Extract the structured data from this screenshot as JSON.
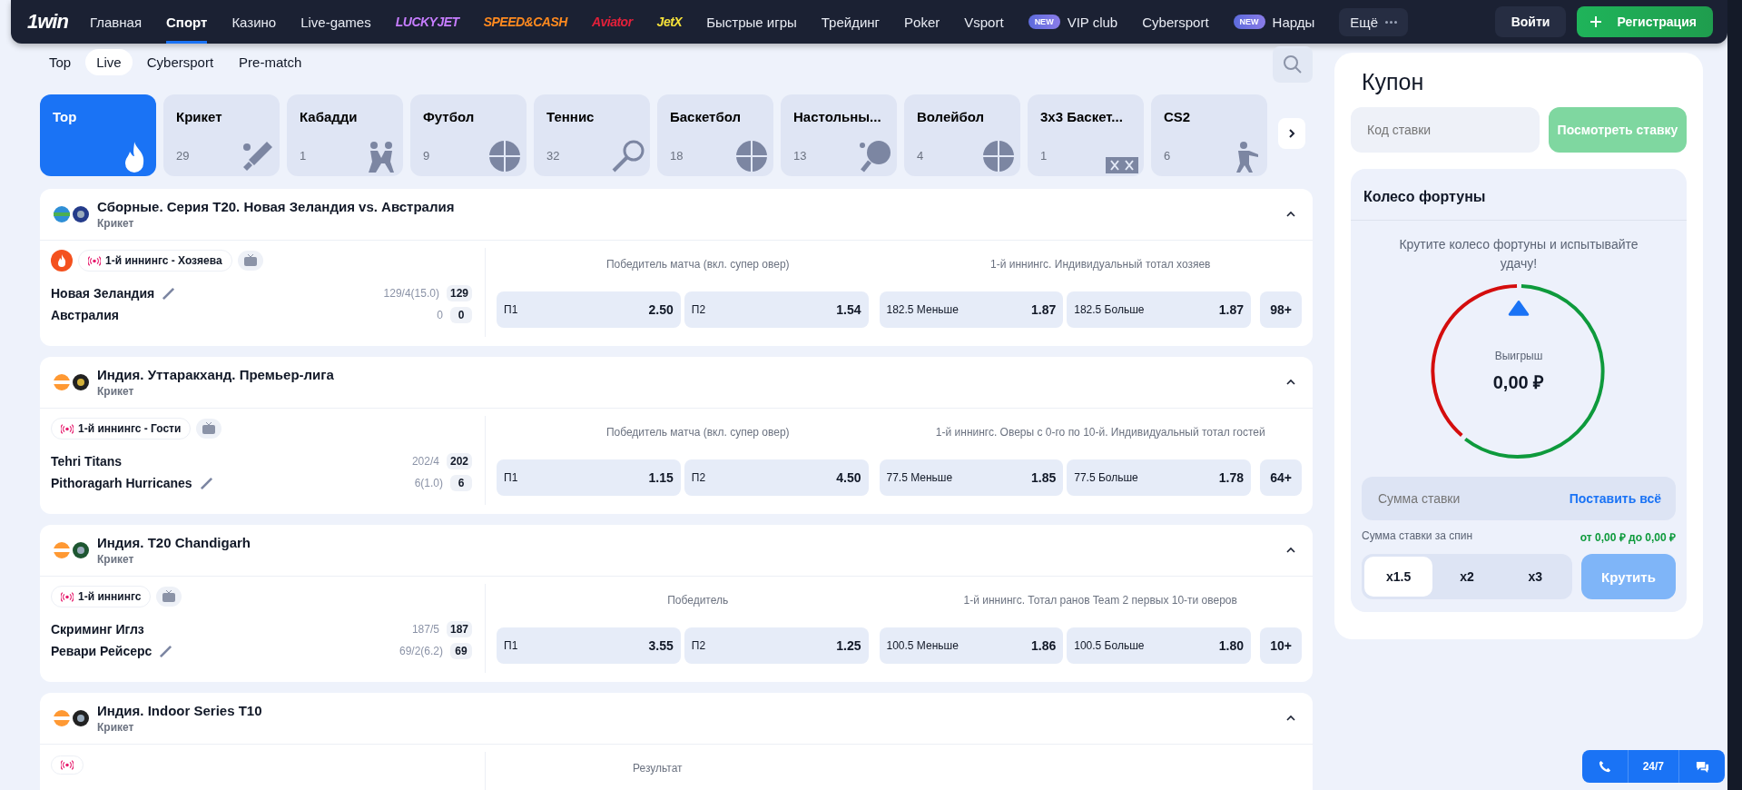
{
  "header": {
    "logo": "1win",
    "nav": [
      {
        "label": "Главная",
        "kind": "text",
        "selected": false
      },
      {
        "label": "Спорт",
        "kind": "text",
        "selected": true
      },
      {
        "label": "Казино",
        "kind": "text",
        "selected": false
      },
      {
        "label": "Live-games",
        "kind": "text",
        "selected": false
      },
      {
        "label": "LUCKYJET",
        "kind": "logo",
        "color": "#c77dff",
        "selected": false
      },
      {
        "label": "SPEED&CASH",
        "kind": "logo",
        "color": "#ff8a1f",
        "selected": false
      },
      {
        "label": "Aviator",
        "kind": "logo",
        "color": "#e3203a",
        "selected": false
      },
      {
        "label": "JetX",
        "kind": "logo",
        "color": "#f5e13a",
        "selected": false
      },
      {
        "label": "Быстрые игры",
        "kind": "text",
        "selected": false
      },
      {
        "label": "Трейдинг",
        "kind": "text",
        "selected": false
      },
      {
        "label": "Poker",
        "kind": "text",
        "selected": false
      },
      {
        "label": "Vsport",
        "kind": "text",
        "selected": false
      },
      {
        "label": "VIP club",
        "kind": "text",
        "badge": "NEW",
        "selected": false
      },
      {
        "label": "Cybersport",
        "kind": "text",
        "selected": false
      },
      {
        "label": "Нарды",
        "kind": "text",
        "badge": "NEW",
        "selected": false
      }
    ],
    "more": "Ещё",
    "login": "Войти",
    "register": "Регистрация"
  },
  "subtabs": [
    {
      "label": "Top",
      "selected": false
    },
    {
      "label": "Live",
      "selected": true
    },
    {
      "label": "Cybersport",
      "selected": false
    },
    {
      "label": "Pre-match",
      "selected": false
    }
  ],
  "sports": [
    {
      "name": "Top",
      "selected": true
    },
    {
      "name": "Крикет",
      "count": "29",
      "selected": false
    },
    {
      "name": "Кабадди",
      "count": "1",
      "selected": false
    },
    {
      "name": "Футбол",
      "count": "9",
      "selected": false
    },
    {
      "name": "Теннис",
      "count": "32",
      "selected": false
    },
    {
      "name": "Баскетбол",
      "count": "18",
      "selected": false
    },
    {
      "name": "Настольны...",
      "count": "13",
      "selected": false
    },
    {
      "name": "Волейбол",
      "count": "4",
      "selected": false
    },
    {
      "name": "3x3 Баскет...",
      "count": "1",
      "selected": false
    },
    {
      "name": "CS2",
      "count": "6",
      "selected": false
    }
  ],
  "matches": [
    {
      "title": "Сборные. Серия T20. Новая Зеландия vs. Австралия",
      "sport": "Крикет",
      "hot": true,
      "status": "1-й иннингс - Хозяева",
      "tv": true,
      "teams": [
        {
          "name": "Новая Зеландия",
          "batting": true,
          "detail": "129/4(15.0)",
          "score": "129"
        },
        {
          "name": "Австралия",
          "batting": false,
          "detail": "0",
          "score": "0"
        }
      ],
      "markets": [
        "Победитель матча (вкл. супер овер)",
        "1-й иннингс. Индивидуальный тотал хозяев"
      ],
      "odds": [
        {
          "label": "П1",
          "value": "2.50"
        },
        {
          "label": "П2",
          "value": "1.54"
        },
        {
          "label": "182.5 Меньше",
          "value": "1.87"
        },
        {
          "label": "182.5 Больше",
          "value": "1.87"
        }
      ],
      "more": "98+"
    },
    {
      "title": "Индия. Уттаракханд. Премьер-лига",
      "sport": "Крикет",
      "hot": false,
      "status": "1-й иннингс - Гости",
      "tv": true,
      "teams": [
        {
          "name": "Tehri Titans",
          "batting": false,
          "detail": "202/4",
          "score": "202"
        },
        {
          "name": "Pithoragarh Hurricanes",
          "batting": true,
          "detail": "6(1.0)",
          "score": "6"
        }
      ],
      "markets": [
        "Победитель матча (вкл. супер овер)",
        "1-й иннингс. Оверы с 0-го по 10-й. Индивидуальный тотал гостей"
      ],
      "odds": [
        {
          "label": "П1",
          "value": "1.15"
        },
        {
          "label": "П2",
          "value": "4.50"
        },
        {
          "label": "77.5 Меньше",
          "value": "1.85"
        },
        {
          "label": "77.5 Больше",
          "value": "1.78"
        }
      ],
      "more": "64+"
    },
    {
      "title": "Индия. T20 Chandigarh",
      "sport": "Крикет",
      "hot": false,
      "status": "1-й иннингс",
      "tv": true,
      "teams": [
        {
          "name": "Скриминг Иглз",
          "batting": false,
          "detail": "187/5",
          "score": "187"
        },
        {
          "name": "Ревари Рейсерс",
          "batting": true,
          "detail": "69/2(6.2)",
          "score": "69"
        }
      ],
      "markets": [
        "Победитель",
        "1-й иннингс. Тотал ранов Team 2 первых 10-ти оверов"
      ],
      "odds": [
        {
          "label": "П1",
          "value": "3.55"
        },
        {
          "label": "П2",
          "value": "1.25"
        },
        {
          "label": "100.5 Меньше",
          "value": "1.86"
        },
        {
          "label": "100.5 Больше",
          "value": "1.80"
        }
      ],
      "more": "10+"
    },
    {
      "title": "Индия. Indoor Series T10",
      "sport": "Крикет",
      "hot": false,
      "tv": false,
      "markets": [
        "Результат"
      ]
    }
  ],
  "coupon": {
    "title": "Купон",
    "code_placeholder": "Код ставки",
    "view_button": "Посмотреть ставку"
  },
  "wheel": {
    "title": "Колесо фортуны",
    "description": "Крутите колесо фортуны и испытывайте удачу!",
    "win_label": "Выигрыш",
    "win_amount": "0,00 ₽",
    "stake_placeholder": "Сумма ставки",
    "stake_all": "Поставить всё",
    "spin_label": "Сумма ставки за спин",
    "range": "от 0,00 ₽ до 0,00 ₽",
    "multipliers": [
      {
        "label": "x1.5",
        "selected": true
      },
      {
        "label": "x2",
        "selected": false
      },
      {
        "label": "x3",
        "selected": false
      }
    ],
    "spin_button": "Крутить"
  },
  "support": {
    "hours": "24/7"
  }
}
